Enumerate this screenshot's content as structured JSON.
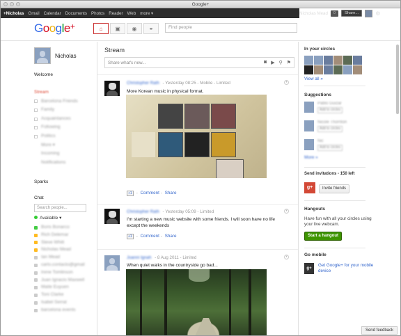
{
  "window": {
    "title": "Google+"
  },
  "gbar": {
    "items": [
      "+Nicholas",
      "Gmail",
      "Calendar",
      "Documents",
      "Photos",
      "Reader",
      "Web",
      "more ▾"
    ],
    "user": "Nicholas Mead",
    "notifications": "0",
    "share": "Share..."
  },
  "header": {
    "search_placeholder": "Find people"
  },
  "left": {
    "name": "Nicholas",
    "welcome": "Welcome",
    "streams": [
      "Stream",
      "Barcelona Friends",
      "Family",
      "Acquaintances",
      "Following",
      "Politics",
      "More ▾",
      "Incoming",
      "Notifications"
    ],
    "sparks": "Sparks",
    "chat": "Chat",
    "chat_search_placeholder": "Search people...",
    "available": "Available ▾",
    "chat_contacts": [
      "Boris Bonarco",
      "Rich Delemar",
      "Steve Whitt",
      "Nicholas Mead",
      "Ian Mead",
      "carlo.contacto@gmail",
      "Irene Tomlinson",
      "Juan Ignacio Maxwell",
      "Maite Euyuen",
      "Toni Clarke",
      "Isabel Serrat",
      "barcelona events"
    ]
  },
  "stream": {
    "title": "Stream",
    "share_placeholder": "Share what's new...",
    "posts": [
      {
        "author": "Christopher Rath",
        "time": "Yesterday 08:25",
        "via": "Mobile",
        "visibility": "Limited",
        "text": "More Korean music in physical format.",
        "plus1": "+1",
        "comment": "Comment",
        "share": "Share"
      },
      {
        "author": "Christopher Rath",
        "time": "Yesterday 05:09",
        "visibility": "Limited",
        "text": "I'm starting a new music website with some friends. I will soon have no life except the weekends",
        "plus1": "+1",
        "comment": "Comment",
        "share": "Share"
      },
      {
        "author": "Joanni Ignah",
        "time": "8 Aug 2011",
        "visibility": "Limited",
        "text": "When quiet walks in the countryside go bad..."
      }
    ]
  },
  "right": {
    "in_circles": "In your circles",
    "view_all": "View all »",
    "suggestions": "Suggestions",
    "suggestion_people": [
      {
        "name": "Pablo Guizar",
        "action": "Add to circles"
      },
      {
        "name": "Nicole Thornton",
        "action": "Add to circles"
      },
      {
        "name": "Nic",
        "action": "Add to circles"
      }
    ],
    "more_link": "More »",
    "invitations": "Send invitations - 150 left",
    "invite_button": "Invite friends",
    "hangouts": "Hangouts",
    "hangouts_text": "Have fun with all your circles using your live webcam.",
    "hangout_button": "Start a hangout",
    "go_mobile": "Go mobile",
    "mobile_link": "Get Google+ for your mobile device",
    "feedback": "Send feedback"
  }
}
